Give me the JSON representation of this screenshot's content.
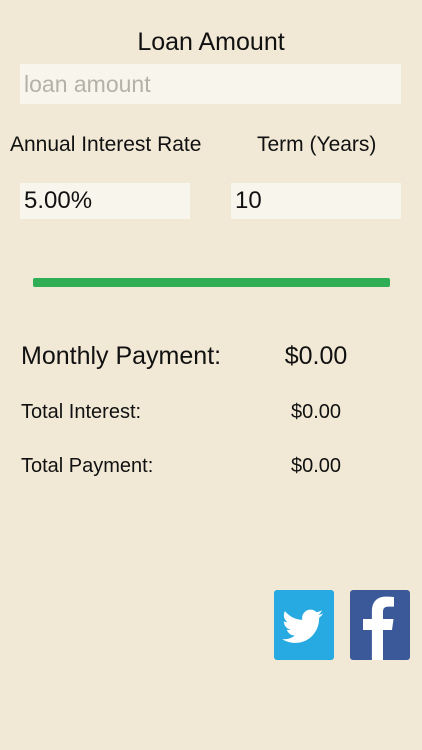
{
  "loan": {
    "title": "Loan Amount",
    "placeholder": "loan amount",
    "value": ""
  },
  "rate": {
    "label": "Annual Interest Rate",
    "value": "5.00%"
  },
  "term": {
    "label": "Term (Years)",
    "value": "10"
  },
  "progress": {
    "percent": 100,
    "color": "#2fae55"
  },
  "results": {
    "monthly_label": "Monthly Payment:",
    "monthly_value": "$0.00",
    "interest_label": "Total Interest:",
    "interest_value": "$0.00",
    "total_label": "Total Payment:",
    "total_value": "$0.00"
  },
  "social": {
    "twitter_icon": "twitter-bird-icon",
    "twitter_color": "#27a9e1",
    "facebook_icon": "facebook-f-icon",
    "facebook_color": "#3b5998"
  },
  "colors": {
    "background": "#f1e9d6",
    "input_background": "#f8f5ec"
  }
}
